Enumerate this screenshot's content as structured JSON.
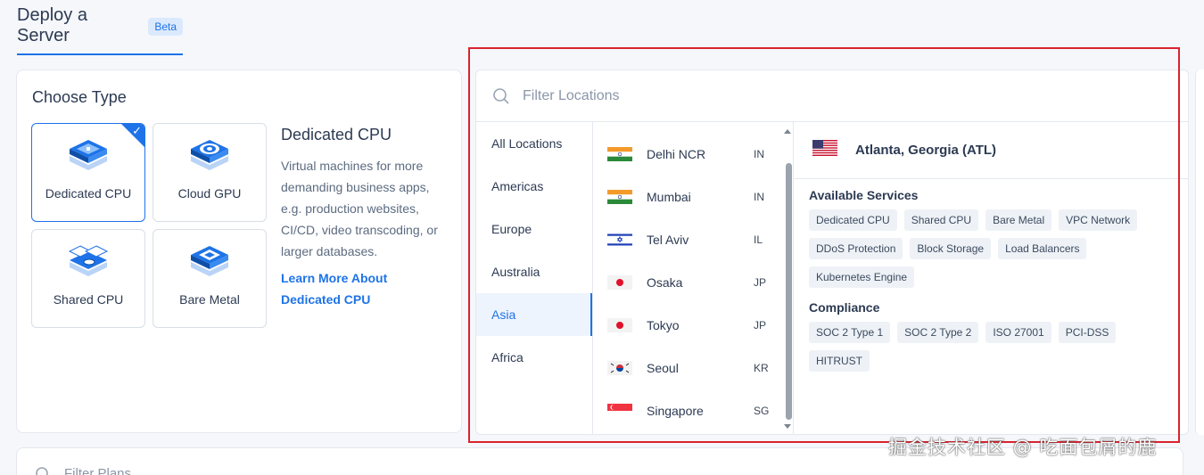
{
  "header": {
    "title": "Deploy a Server",
    "badge": "Beta"
  },
  "choose_type": {
    "heading": "Choose Type",
    "tiles": [
      {
        "label": "Dedicated CPU",
        "selected": true
      },
      {
        "label": "Cloud GPU",
        "selected": false
      },
      {
        "label": "Shared CPU",
        "selected": false
      },
      {
        "label": "Bare Metal",
        "selected": false
      }
    ],
    "description": {
      "title": "Dedicated CPU",
      "body": "Virtual machines for more demanding business apps, e.g. production websites, CI/CD, video transcoding, or larger databases.",
      "link": "Learn More About Dedicated CPU"
    }
  },
  "locations": {
    "filter_placeholder": "Filter Locations",
    "regions": [
      "All Locations",
      "Americas",
      "Europe",
      "Australia",
      "Asia",
      "Africa"
    ],
    "active_region": "Asia",
    "cities": [
      {
        "name": "Delhi NCR",
        "code": "IN",
        "flag": "india"
      },
      {
        "name": "Mumbai",
        "code": "IN",
        "flag": "india"
      },
      {
        "name": "Tel Aviv",
        "code": "IL",
        "flag": "israel"
      },
      {
        "name": "Osaka",
        "code": "JP",
        "flag": "japan"
      },
      {
        "name": "Tokyo",
        "code": "JP",
        "flag": "japan"
      },
      {
        "name": "Seoul",
        "code": "KR",
        "flag": "korea"
      },
      {
        "name": "Singapore",
        "code": "SG",
        "flag": "singapore"
      }
    ],
    "detail": {
      "name": "Atlanta, Georgia (ATL)",
      "flag": "usa",
      "services_title": "Available Services",
      "services": [
        "Dedicated CPU",
        "Shared CPU",
        "Bare Metal",
        "VPC Network",
        "DDoS Protection",
        "Block Storage",
        "Load Balancers",
        "Kubernetes Engine"
      ],
      "compliance_title": "Compliance",
      "compliance": [
        "SOC 2 Type 1",
        "SOC 2 Type 2",
        "ISO 27001",
        "PCI-DSS",
        "HITRUST"
      ]
    }
  },
  "plans": {
    "filter_placeholder": "Filter Plans"
  },
  "watermark": "掘金技术社区 @ 吃面包屑的鹿",
  "colors": {
    "accent": "#1e73e8",
    "highlight_box": "#d9232e"
  }
}
